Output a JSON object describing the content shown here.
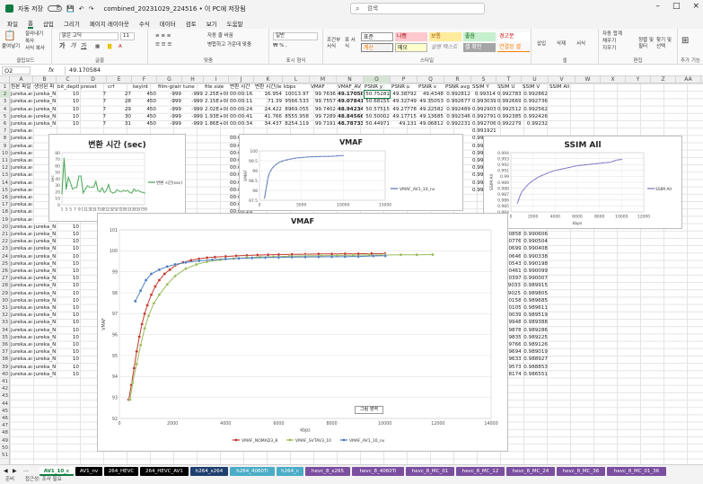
{
  "titlebar": {
    "autosave": "자동 저장",
    "autosave_state": "끔",
    "filename": "combined_20231029_224516 • 이 PC에 저장됨",
    "search_placeholder": "검색"
  },
  "menu": [
    "파일",
    "홈",
    "삽입",
    "그리기",
    "페이지 레이아웃",
    "수식",
    "데이터",
    "검토",
    "보기",
    "도움말"
  ],
  "ribbon": {
    "clipboard": {
      "paste": "붙여넣기",
      "cut": "잘라내기",
      "copy": "복사",
      "painter": "서식 복사",
      "label": "클립보드"
    },
    "font": {
      "name": "맑은 고딕",
      "size": "11",
      "label": "글꼴"
    },
    "align": {
      "wrap": "자동 줄 바꿈",
      "merge": "병합하고 가운데 맞춤",
      "label": "맞춤"
    },
    "number": {
      "format": "일반",
      "label": "표시 형식"
    },
    "styles": {
      "cond": "조건부 서식",
      "table": "표 서식",
      "cells": [
        "표준",
        "나쁨",
        "보통",
        "좋음",
        "경고문",
        "계산",
        "메모",
        "설명 텍스트",
        "셀 확인",
        "연결된 셀"
      ],
      "label": "스타일"
    },
    "cells": {
      "insert": "삽입",
      "delete": "삭제",
      "format": "서식",
      "label": "셀"
    },
    "editing": {
      "autosum": "자동 합계",
      "fill": "채우기",
      "clear": "지우기",
      "sort": "정렬 및 필터",
      "find": "찾기 및 선택",
      "label": "편집"
    },
    "addins": {
      "label": "추가 기능"
    }
  },
  "formula_bar": {
    "cell": "O2",
    "fx": "fx",
    "value": "49.170584"
  },
  "columns": [
    "A",
    "B",
    "C",
    "D",
    "E",
    "F",
    "G",
    "H",
    "I",
    "J",
    "K",
    "L",
    "M",
    "N",
    "O",
    "P",
    "Q",
    "R",
    "S",
    "T",
    "U",
    "V",
    "W",
    "X",
    "Y",
    "Z",
    "AA",
    "AB"
  ],
  "header_row": [
    "원본 파일",
    "생성된 파",
    "bit_depth",
    "preset",
    "crf",
    "keyint",
    "film-grain",
    "tune",
    "file size",
    "변환 시간",
    "변환 시간(length2",
    "kbps",
    "VMAF",
    "VMAF_AV",
    "PSNR y",
    "PSNR u",
    "PSNR v",
    "PSNR avg",
    "SSIM Y",
    "SSIM U",
    "SSIM V",
    "SSIM All"
  ],
  "rows": [
    [
      "jureka.avs",
      "jureka_NV",
      "10",
      "7",
      "27",
      "450",
      "-999",
      "-999",
      "2.25E+08",
      "00:00:16.91",
      "16.954",
      "10013.97",
      "99.7636",
      "49.17058",
      "50.75281",
      "49.38792",
      "49.4348",
      "0.992812",
      "0.99314",
      "0.992783",
      "0.992862"
    ],
    [
      "jureka.avs",
      "jureka_NV",
      "10",
      "7",
      "28",
      "450",
      "-999",
      "-999",
      "2.15E+08",
      "00:00:11.35",
      "71.39",
      "9566.533",
      "99.7557",
      "49.07841",
      "50.68155",
      "49.32749",
      "49.35053",
      "0.992677",
      "0.993039",
      "0.992669",
      "0.992736"
    ],
    [
      "jureka.avs",
      "jureka_NV",
      "10",
      "7",
      "29",
      "450",
      "-999",
      "-999",
      "2.02E+08",
      "00:00:24.18",
      "24.422",
      "8969.055",
      "99.7402",
      "48.94234",
      "50.57515",
      "49.27778",
      "49.22582",
      "0.992489",
      "0.992903",
      "0.992512",
      "0.992562"
    ],
    [
      "jureka.avs",
      "jureka_NV",
      "10",
      "7",
      "30",
      "450",
      "-999",
      "-999",
      "1.93E+08",
      "00:00:41.70",
      "41.766",
      "8555.958",
      "99.7289",
      "48.84566",
      "50.50002",
      "49.17715",
      "49.13685",
      "0.992346",
      "0.992791",
      "0.992385",
      "0.992426"
    ],
    [
      "jureka.avs",
      "jureka_NV",
      "10",
      "7",
      "31",
      "450",
      "-999",
      "-999",
      "1.86E+08",
      "00:00:34.45",
      "34.437",
      "8254.119",
      "99.7191",
      "48.78733",
      "50.44971",
      "49.131",
      "49.06812",
      "0.992231",
      "0.992706",
      "0.992279",
      "0.99232"
    ]
  ],
  "partial_col_j": [
    "00:00:24.0",
    "00:00:26.3",
    "00:00:26.7",
    "00:00:44.2",
    "00:00:44.2",
    "00:00:18.0",
    "00:00:23.5",
    "00:00:29.0",
    "00:00:26.7",
    "00:00:26.7",
    "00:00:26.7",
    "00:00:35.7"
  ],
  "col_s_tail": [
    "0.991921",
    "0.991807",
    "0.991539",
    "0.991375",
    "0.991248",
    "0.991114",
    "0.991018",
    "0.990884",
    "0.990816"
  ],
  "col_uv_tail": [
    [
      "0.990858",
      "0.990606"
    ],
    [
      "0.990776",
      "0.990504"
    ],
    [
      "0.990699",
      "0.990408"
    ],
    [
      "0.990646",
      "0.990338"
    ],
    [
      "0.990543",
      "0.990198"
    ],
    [
      "0.990461",
      "0.990099"
    ],
    [
      "0.990397",
      "0.990007"
    ],
    [
      "0.99033",
      "0.989915"
    ],
    [
      "0.99025",
      "0.989805"
    ],
    [
      "0.990158",
      "0.989685"
    ],
    [
      "0.990105",
      "0.989611"
    ],
    [
      "0.990039",
      "0.989519"
    ],
    [
      "0.989948",
      "0.989388"
    ],
    [
      "0.989878",
      "0.989286"
    ],
    [
      "0.989835",
      "0.989225"
    ],
    [
      "0.989766",
      "0.989126"
    ],
    [
      "0.989694",
      "0.989019"
    ],
    [
      "0.989633",
      "0.988927"
    ],
    [
      "0.989573",
      "0.988853"
    ],
    [
      "0.988174",
      "0.986551"
    ]
  ],
  "row_numbers": [
    "1",
    "2",
    "3",
    "4",
    "5",
    "6",
    "7",
    "8",
    "9",
    "10",
    "11",
    "12",
    "13",
    "14",
    "15",
    "16",
    "17",
    "18",
    "19",
    "20",
    "21",
    "22",
    "23",
    "24",
    "25",
    "26",
    "27",
    "28",
    "29",
    "30",
    "31",
    "32",
    "33",
    "34",
    "35",
    "36",
    "37",
    "38",
    "39",
    "40",
    "41",
    "42",
    "43",
    "44",
    "45",
    "46",
    "47",
    "48",
    "49",
    "50",
    "51"
  ],
  "colors": {
    "ribbon_bg": "#f9f9f9",
    "green_tab": "#107c41",
    "nomad": "#c0392b",
    "svtav1": "#9bbb59",
    "av1nv": "#4a7ebb",
    "vmaf_line": "#4f6fb3",
    "ssim_line": "#7a6fbf",
    "time_line": "#3fa34d"
  },
  "chart_data": [
    {
      "type": "line",
      "title": "변환 시간 (sec)",
      "ylabel": "sec",
      "ylim": [
        0,
        80
      ],
      "yticks": [
        "0",
        "10",
        "20",
        "30",
        "40",
        "50",
        "60",
        "70",
        "80"
      ],
      "xticks": [
        "1",
        "3",
        "5",
        "7",
        "9",
        "11",
        "13",
        "15",
        "17",
        "19",
        "21",
        "23",
        "25",
        "27",
        "29",
        "31",
        "33",
        "35",
        "37",
        "39"
      ],
      "series": [
        {
          "name": "변환 시간(sec)",
          "values": [
            17,
            71,
            24,
            42,
            34,
            24,
            26,
            27,
            44,
            44,
            18,
            24,
            29,
            27,
            27,
            27,
            36,
            22,
            20,
            26,
            19,
            22,
            31,
            20,
            18,
            19,
            23,
            21,
            20,
            22,
            21,
            22,
            19,
            18,
            24,
            21,
            22,
            20,
            19,
            18
          ]
        }
      ]
    },
    {
      "type": "line",
      "title": "VMAF",
      "ylabel": "VMAF",
      "ylim": [
        97.5,
        100
      ],
      "yticks": [
        "97.5",
        "98",
        "98.5",
        "99",
        "99.5",
        "100"
      ],
      "xticks": [
        "0",
        "5000",
        "10000",
        "15000"
      ],
      "series": [
        {
          "name": "VMAF_AV1_10_nv",
          "x": [
            600,
            800,
            1000,
            1200,
            1500,
            1800,
            2100,
            2500,
            3000,
            3500,
            4000,
            4500,
            5000,
            5500,
            6000,
            6500,
            7000,
            7500,
            8000,
            8500,
            9000,
            9566,
            10014
          ],
          "y": [
            97.6,
            98.1,
            98.6,
            98.9,
            99.1,
            99.25,
            99.35,
            99.45,
            99.52,
            99.57,
            99.61,
            99.64,
            99.66,
            99.68,
            99.69,
            99.7,
            99.71,
            99.715,
            99.72,
            99.725,
            99.73,
            99.756,
            99.764
          ]
        }
      ]
    },
    {
      "type": "line",
      "title": "SSIM All",
      "ylabel": "SSIM All",
      "xlabel": "kbps",
      "ylim": [
        0.984,
        0.994
      ],
      "yticks": [
        "0.984",
        "0.985",
        "0.986",
        "0.987",
        "0.988",
        "0.989",
        "0.99",
        "0.991",
        "0.992",
        "0.993",
        "0.994"
      ],
      "xticks": [
        "0",
        "2000",
        "4000",
        "6000",
        "8000",
        "10000",
        "12000"
      ],
      "series": [
        {
          "name": "SSIM All",
          "x": [
            600,
            800,
            1000,
            1300,
            1600,
            2000,
            2500,
            3000,
            3500,
            4000,
            4500,
            5000,
            5500,
            6000,
            6500,
            7000,
            7500,
            8000,
            8500,
            9000,
            9566,
            10014
          ],
          "y": [
            0.9855,
            0.9866,
            0.9874,
            0.9881,
            0.9887,
            0.9893,
            0.9899,
            0.9903,
            0.9907,
            0.991,
            0.9912,
            0.9914,
            0.9916,
            0.9918,
            0.9919,
            0.992,
            0.9921,
            0.9922,
            0.9923,
            0.9924,
            0.99274,
            0.99286
          ]
        }
      ]
    },
    {
      "type": "line",
      "title": "VMAF",
      "ylabel": "VMAF",
      "xlabel": "kbps",
      "ylim": [
        92,
        101
      ],
      "xlim": [
        0,
        14000
      ],
      "yticks": [
        "92",
        "93",
        "94",
        "95",
        "96",
        "97",
        "98",
        "99",
        "100",
        "101"
      ],
      "xticks": [
        "0",
        "2000",
        "4000",
        "6000",
        "8000",
        "10000",
        "12000",
        "14000"
      ],
      "legend": "bottom",
      "button": "그림 영역",
      "series": [
        {
          "name": "VMAF_NOMAD3_8",
          "x": [
            350,
            450,
            550,
            650,
            750,
            850,
            950,
            1050,
            1200,
            1350,
            1500,
            1700,
            1900,
            2100,
            2400,
            2700,
            3000,
            3300,
            3600,
            4000,
            4400,
            4800,
            5200,
            5600,
            6000,
            6500,
            7000,
            7500,
            8000,
            8500,
            9000,
            9500,
            10000
          ],
          "y": [
            92.9,
            93.6,
            94.4,
            95.2,
            95.9,
            96.5,
            97.0,
            97.4,
            97.9,
            98.3,
            98.6,
            98.9,
            99.1,
            99.3,
            99.45,
            99.55,
            99.62,
            99.67,
            99.7,
            99.73,
            99.76,
            99.78,
            99.8,
            99.81,
            99.82,
            99.83,
            99.84,
            99.85,
            99.85,
            99.86,
            99.86,
            99.87,
            99.87
          ]
        },
        {
          "name": "VMAF_SVTAV3_10",
          "x": [
            400,
            500,
            650,
            800,
            950,
            1100,
            1300,
            1500,
            1800,
            2100,
            2500,
            2900,
            3300,
            3800,
            4300,
            4800,
            5300,
            5800,
            6400,
            7000,
            7600,
            8200,
            8800,
            9400,
            10000,
            10600,
            11200,
            11800
          ],
          "y": [
            92.9,
            93.7,
            94.6,
            95.5,
            96.3,
            96.9,
            97.5,
            97.9,
            98.4,
            98.8,
            99.15,
            99.35,
            99.48,
            99.57,
            99.63,
            99.67,
            99.7,
            99.72,
            99.74,
            99.76,
            99.77,
            99.78,
            99.79,
            99.8,
            99.8,
            99.81,
            99.81,
            99.82
          ]
        },
        {
          "name": "VMAF_AV1_10_nv",
          "x": [
            600,
            800,
            1000,
            1200,
            1500,
            1800,
            2100,
            2500,
            3000,
            3500,
            4000,
            4500,
            5000,
            5500,
            6000,
            6500,
            7000,
            7500,
            8000,
            8500,
            9000,
            9566,
            10014
          ],
          "y": [
            97.6,
            98.1,
            98.6,
            98.9,
            99.1,
            99.25,
            99.35,
            99.45,
            99.52,
            99.57,
            99.61,
            99.64,
            99.66,
            99.68,
            99.69,
            99.7,
            99.71,
            99.715,
            99.72,
            99.725,
            99.73,
            99.756,
            99.764
          ]
        }
      ]
    }
  ],
  "sheet_tabs": [
    "AV1_10_c",
    "AV1_nv",
    "264_HEVC",
    "264_HEVC_AV1",
    "h264_x264",
    "h264_4060Ti",
    "h264_c",
    "hevc_8_x265",
    "hevc_8_4060Ti",
    "hevc_8_MC_01",
    "hevc_8_MC_12",
    "hevc_8_MC_24",
    "hevc_8_MC_36",
    "hevc_8_MC_01_36",
    "hevc_8_MC_01_36"
  ],
  "status": {
    "ready": "준비",
    "accessibility": "접근성: 조사 필요"
  }
}
